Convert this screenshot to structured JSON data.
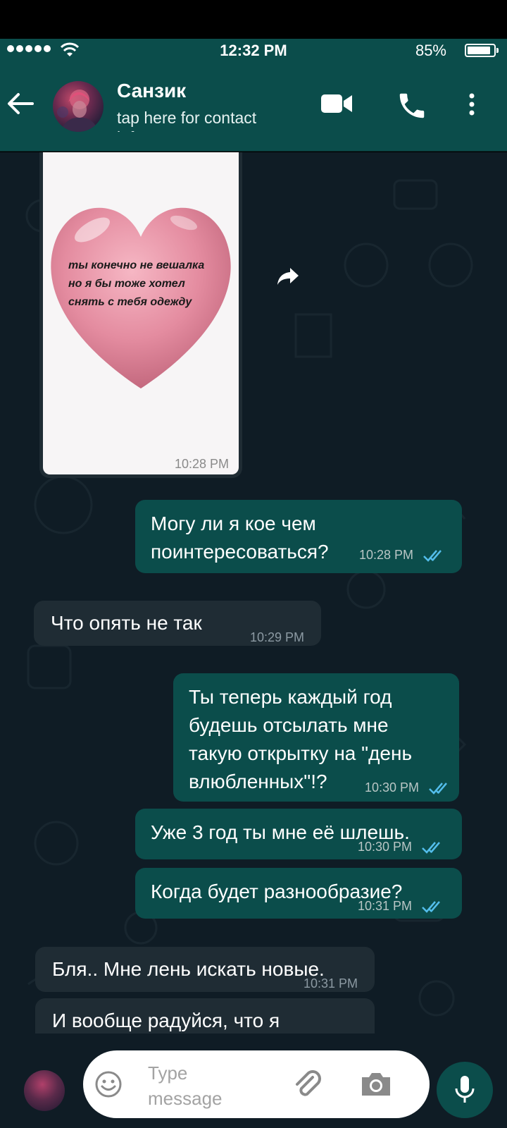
{
  "status_bar": {
    "time": "12:32 PM",
    "battery": "85%"
  },
  "header": {
    "contact_name": "Санзик",
    "subtitle": "tap here for contact info"
  },
  "messages": [
    {
      "id": "image",
      "direction": "incoming",
      "image_caption": "ты конечно не вешалка\nно я бы тоже хотел\nснять с тебя одежду",
      "time": "10:28 PM"
    },
    {
      "id": "m1",
      "direction": "outgoing",
      "text": "Могу ли я кое чем\nпоинтересоваться?",
      "time": "10:28 PM",
      "status": "read"
    },
    {
      "id": "m2",
      "direction": "incoming",
      "text": "Что опять не так",
      "time": "10:29 PM"
    },
    {
      "id": "m3",
      "direction": "outgoing",
      "text": "Ты теперь каждый год\nбудешь отсылать мне\nтакую открытку на \"день\nвлюбленных\"!?",
      "time": "10:30 PM",
      "status": "read"
    },
    {
      "id": "m4",
      "direction": "outgoing",
      "text": "Уже 3 год ты мне её шлешь.",
      "time": "10:30 PM",
      "status": "read"
    },
    {
      "id": "m5",
      "direction": "outgoing",
      "text": "Когда будет разнообразие?",
      "time": "10:31 PM",
      "status": "read"
    },
    {
      "id": "m6",
      "direction": "incoming",
      "text": "Бля.. Мне лень искать новые.",
      "time": "10:31 PM"
    },
    {
      "id": "m7",
      "direction": "incoming",
      "text": "И вообще радуйся, что я",
      "time": ""
    }
  ],
  "input": {
    "placeholder": "Type message"
  },
  "colors": {
    "header_bg": "#0b4d4b",
    "chat_bg": "#0f1c25",
    "incoming_bubble": "#1f2c34",
    "outgoing_bubble": "#0b4d4b",
    "read_ticks": "#53bdeb"
  }
}
